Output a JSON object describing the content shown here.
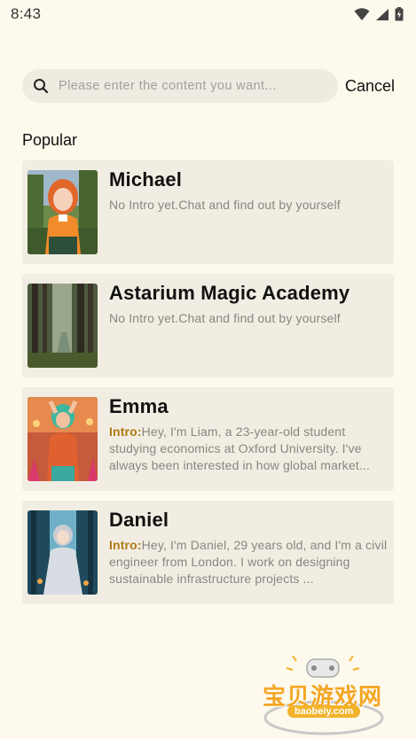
{
  "status_bar": {
    "time": "8:43"
  },
  "search": {
    "placeholder": "Please enter the content you want...",
    "cancel_label": "Cancel"
  },
  "section_title": "Popular",
  "cards": [
    {
      "name": "Michael",
      "intro_label": "",
      "description": "No Intro yet.Chat and find out by yourself"
    },
    {
      "name": "Astarium Magic Academy",
      "intro_label": "",
      "description": "No Intro yet.Chat and find out by yourself"
    },
    {
      "name": "Emma",
      "intro_label": "Intro:",
      "description": "Hey, I'm Liam, a 23-year-old student studying economics at Oxford University. I've always been interested in how global market..."
    },
    {
      "name": "Daniel",
      "intro_label": "Intro:",
      "description": "Hey, I'm Daniel, 29 years old, and I'm a civil engineer from London. I work on designing sustainable infrastructure projects ..."
    }
  ],
  "watermark": {
    "title": "宝贝游戏网",
    "url": "baobeiy.com"
  },
  "colors": {
    "background": "#fdf9ec",
    "card": "#f1ede2",
    "intro_accent": "#b07a15"
  }
}
